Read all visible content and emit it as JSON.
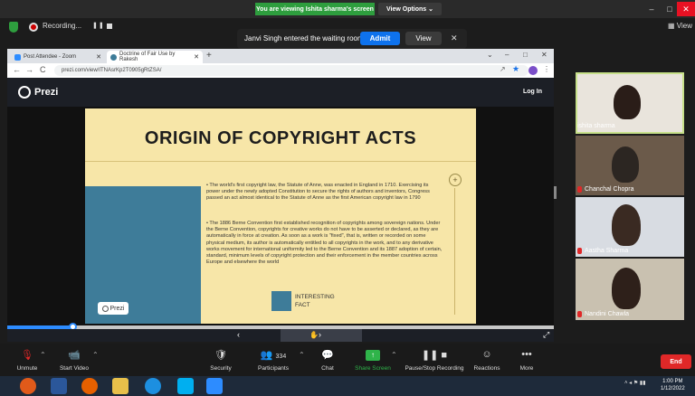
{
  "zoom": {
    "share_banner": "You are viewing Ishita sharma's screen",
    "view_options": "View Options ⌄",
    "recording_label": "Recording...",
    "pause_icon": "pause-icon",
    "stop_icon": "stop-icon",
    "view_label": "▦ View",
    "waiting_text": "Janvi Singh entered the waiting room",
    "admit_label": "Admit",
    "view_button": "View",
    "close_label": "✕",
    "minimize": "–",
    "maximize": "□",
    "close": "✕",
    "accent": "#0e72ed",
    "banner_color": "#2e9e3e"
  },
  "browser": {
    "tabs": [
      {
        "label": "Post Attendee - Zoom",
        "close": "✕"
      },
      {
        "label": "Doctrine of Fair Use by Rakesh",
        "close": "✕"
      }
    ],
    "new_tab": "+",
    "controls": {
      "collapse": "⌄",
      "minimize": "–",
      "maximize": "□",
      "close": "✕"
    },
    "nav": {
      "back": "←",
      "forward": "→",
      "reload": "C"
    },
    "url": "prezi.com/view/ITNAsrKp2T0905gRtZSA/"
  },
  "prezi": {
    "logo": "Prezi",
    "login": "Log In",
    "slide_title": "ORIGIN OF COPYRIGHT ACTS",
    "plus": "+",
    "paragraph_1": "• The world's first copyright law, the Statute of Anne, was enacted in England in 1710. Exercising its power under the newly adopted Constitution to secure the rights of authors and inventors, Congress passed an act almost identical to the Statute of Anne as the first American copyright law in 1790",
    "paragraph_2": "• The 1886 Berne Convention first established recognition of copyrights among sovereign nations. Under the Berne Convention, copyrights for creative works do not have to be asserted or declared, as they are automatically in force at creation. As soon as a work is \"fixed\", that is, written or recorded on some physical medium, its author is automatically entitled to all copyrights in the work, and to any derivative works movement for international uniformity led to the Berne Convention and its 1887 adoption of certain, standard, minimum levels of copyright protection and their enforcement in the member countries across Europe and elsewhere the world",
    "badge": "Prezi",
    "fact_line1": "INTERESTING",
    "fact_line2": "FACT",
    "prev": "‹",
    "next": "›",
    "expand": "⤢",
    "progress": 0.12
  },
  "participants": [
    {
      "name": "ishita sharma",
      "muted": false,
      "active": true
    },
    {
      "name": "Chanchal Chopra",
      "muted": true,
      "active": false
    },
    {
      "name": "Aastha Sharma",
      "muted": true,
      "active": false
    },
    {
      "name": "Nandini Chawla",
      "muted": true,
      "active": false
    }
  ],
  "toolbar": {
    "unmute": "Unmute",
    "start_video": "Start Video",
    "security": "Security",
    "participants": "Participants",
    "participants_count": "334",
    "chat": "Chat",
    "share_screen": "Share Screen",
    "pause_stop": "Pause/Stop Recording",
    "reactions": "Reactions",
    "more": "More",
    "end": "End",
    "caret": "⌃"
  },
  "taskbar": {
    "time": "1:00 PM",
    "date": "1/12/2022",
    "tray": "˄ ◂ ⚑ ▮▮"
  }
}
